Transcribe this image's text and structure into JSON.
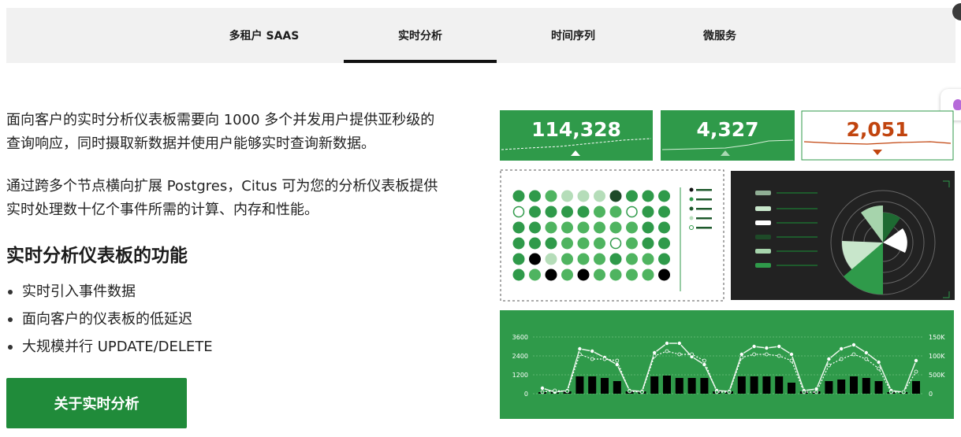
{
  "tabs": [
    {
      "label": "多租户 SAAS",
      "active": false
    },
    {
      "label": "实时分析",
      "active": true
    },
    {
      "label": "时间序列",
      "active": false
    },
    {
      "label": "微服务",
      "active": false
    }
  ],
  "content": {
    "paragraph1": "面向客户的实时分析仪表板需要向 1000 多个并发用户提供亚秒级的查询响应，同时摄取新数据并使用户能够实时查询新数据。",
    "paragraph2": "通过跨多个节点横向扩展 Postgres，Citus 可为您的分析仪表板提供实时处理数十亿个事件所需的计算、内存和性能。",
    "heading": "实时分析仪表板的功能",
    "features": [
      "实时引入事件数据",
      "面向客户的仪表板的低延迟",
      "大规模并行 UPDATE/DELETE"
    ],
    "cta_label": "关于实时分析"
  },
  "dashboard": {
    "kpis": [
      {
        "value": "114,328",
        "trend": "up"
      },
      {
        "value": "4,327",
        "trend": "up"
      },
      {
        "value": "2,051",
        "trend": "down"
      }
    ],
    "chart_left_axis": [
      "3600",
      "2400",
      "1200",
      "0"
    ],
    "chart_right_axis": [
      "150K",
      "100K",
      "500K",
      "0"
    ]
  },
  "colors": {
    "brand_green": "#2f9a4a",
    "cta_green": "#208b3a",
    "alert_orange": "#c1440e",
    "dark_panel": "#222222"
  },
  "icons": [
    "lightbulb-icon"
  ]
}
